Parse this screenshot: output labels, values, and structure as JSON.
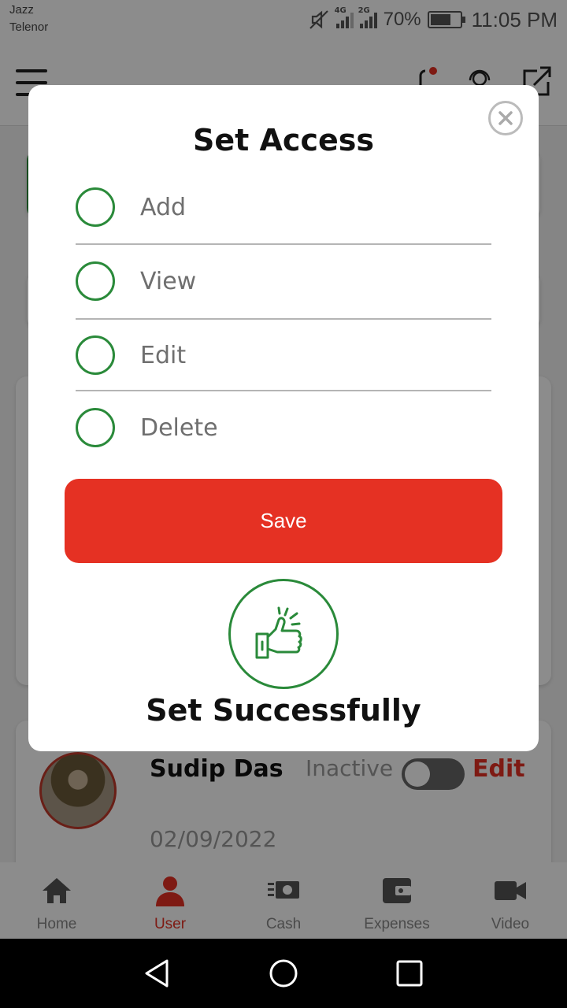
{
  "status_bar": {
    "carrier_1": "Jazz",
    "carrier_2": "Telenor",
    "network_1": "4G",
    "network_2": "2G",
    "battery_percent": "70%",
    "battery_level": 0.7,
    "time": "11:05 PM"
  },
  "header": {
    "menu_icon": "hamburger-icon",
    "icons": [
      "notification-icon",
      "support-headset-icon",
      "external-link-icon"
    ]
  },
  "background_card": {
    "name": "Sudip Das",
    "status": "Inactive",
    "edit_label": "Edit",
    "date": "02/09/2022"
  },
  "bottom_nav": {
    "items": [
      {
        "label": "Home",
        "icon": "home-icon"
      },
      {
        "label": "User",
        "icon": "user-icon",
        "active": true
      },
      {
        "label": "Cash",
        "icon": "cash-icon"
      },
      {
        "label": "Expenses",
        "icon": "wallet-icon"
      },
      {
        "label": "Video",
        "icon": "video-icon"
      }
    ]
  },
  "modal": {
    "title": "Set Access",
    "options": [
      "Add",
      "View",
      "Edit",
      "Delete"
    ],
    "save_label": "Save",
    "success_text": "Set Successfully",
    "success_icon": "thumbs-up-icon",
    "close_icon": "close-icon"
  },
  "colors": {
    "accent_red": "#e53123",
    "accent_green": "#2a8a3a"
  }
}
